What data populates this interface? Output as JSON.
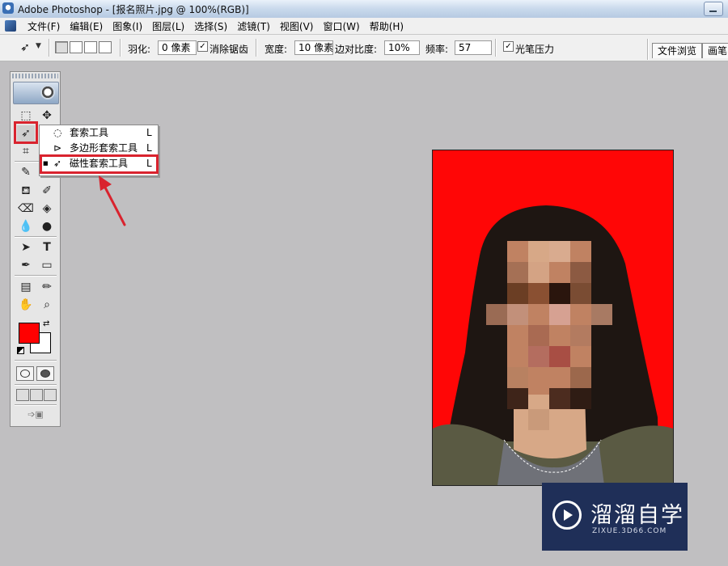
{
  "window": {
    "title": "Adobe Photoshop - [报名照片.jpg @ 100%(RGB)]"
  },
  "menu": {
    "items": [
      "文件(F)",
      "编辑(E)",
      "图象(I)",
      "图层(L)",
      "选择(S)",
      "滤镜(T)",
      "视图(V)",
      "窗口(W)",
      "帮助(H)"
    ]
  },
  "options": {
    "feather_label": "羽化:",
    "feather_value": "0 像素",
    "antialias_label": "消除锯齿",
    "antialias_checked": true,
    "width_label": "宽度:",
    "width_value": "10 像素",
    "edge_contrast_label": "边对比度:",
    "edge_contrast_value": "10%",
    "frequency_label": "频率:",
    "frequency_value": "57",
    "stylus_label": "光笔压力",
    "stylus_checked": true,
    "tabs": [
      "文件浏览",
      "画笔"
    ]
  },
  "toolbox": {
    "foreground_color": "#ff0000",
    "background_color": "#ffffff"
  },
  "flyout": {
    "items": [
      {
        "icon": "lasso-icon",
        "label": "套索工具",
        "key": "L",
        "selected": false
      },
      {
        "icon": "polygonal-lasso-icon",
        "label": "多边形套索工具",
        "key": "L",
        "selected": false
      },
      {
        "icon": "magnetic-lasso-icon",
        "label": "磁性套索工具",
        "key": "L",
        "selected": true
      }
    ]
  },
  "document": {
    "background_color": "#ff0606"
  },
  "watermark": {
    "brand": "溜溜自学",
    "url": "ZIXUE.3D66.COM"
  },
  "annotations": {
    "highlight_color": "#d9232e"
  }
}
